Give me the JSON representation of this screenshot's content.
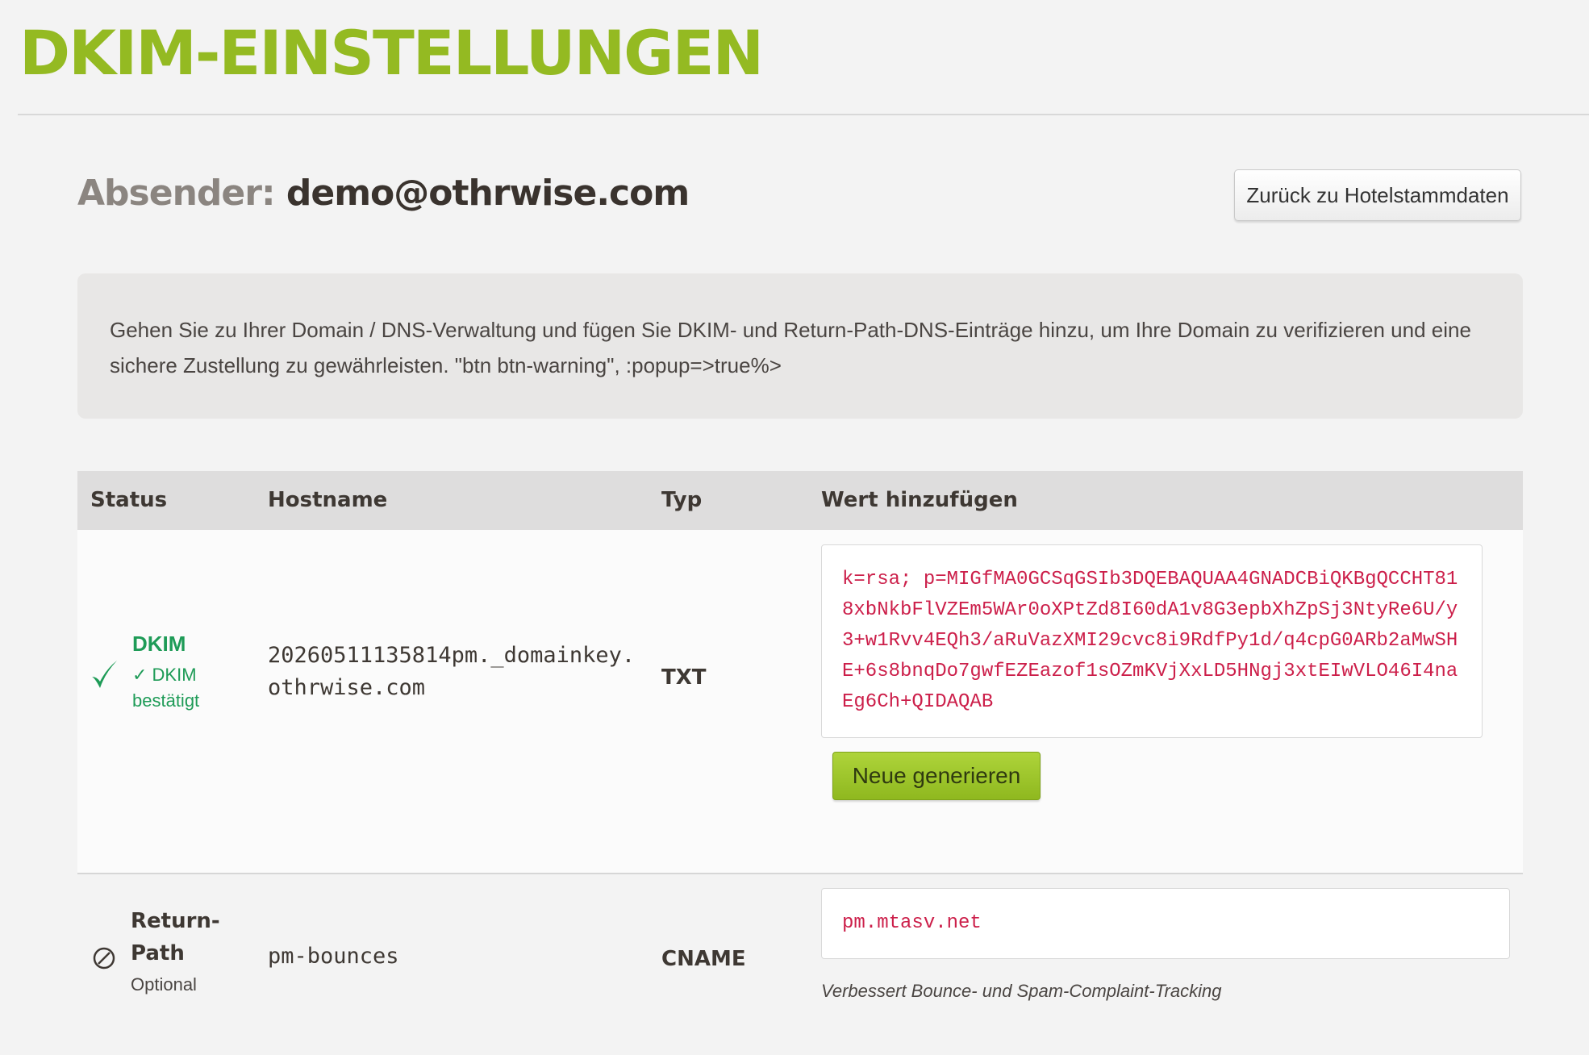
{
  "page": {
    "title": "DKIM-EINSTELLUNGEN",
    "sender_label": "Absender:",
    "sender_value": "demo@othrwise.com",
    "back_button": "Zurück zu Hotelstammdaten"
  },
  "info": {
    "text": "Gehen Sie zu Ihrer Domain / DNS-Verwaltung und fügen Sie DKIM- und Return-Path-DNS-Einträge hinzu, um Ihre Domain zu verifizieren und eine sichere Zustellung zu gewährleisten. \"btn btn-warning\", :popup=>true%>"
  },
  "table": {
    "headers": [
      "Status",
      "Hostname",
      "Typ",
      "Wert hinzufügen"
    ],
    "rows": [
      {
        "status_icon": "check-icon",
        "status_name": "DKIM",
        "status_detail": "✓ DKIM bestätigt",
        "hostname": "20260511135814pm._domainkey.othrwise.com",
        "type": "TXT",
        "value": "k=rsa; p=MIGfMA0GCSqGSIb3DQEBAQUAA4GNADCBiQKBgQCCHT818xbNkbFlVZEm5WAr0oXPtZd8I60dA1v8G3epbXhZpSj3NtyRe6U/y3+w1Rvv4EQh3/aRuVazXMI29cvc8i9RdfPy1d/q4cpG0ARb2aMwSHE+6s8bnqDo7gwfEZEazof1sOZmKVjXxLD5HNgj3xtEIwVLO46I4naEg6Ch+QIDAQAB",
        "action_button": "Neue generieren"
      },
      {
        "status_icon": "block-icon",
        "status_name": "Return-Path",
        "status_detail": "Optional",
        "hostname": "pm-bounces",
        "type": "CNAME",
        "value": "pm.mtasv.net",
        "hint": "Verbessert Bounce- und Spam-Complaint-Tracking"
      }
    ]
  },
  "colors": {
    "accent": "#94ba22",
    "success": "#1e9b57",
    "code": "#cc1f4a"
  }
}
